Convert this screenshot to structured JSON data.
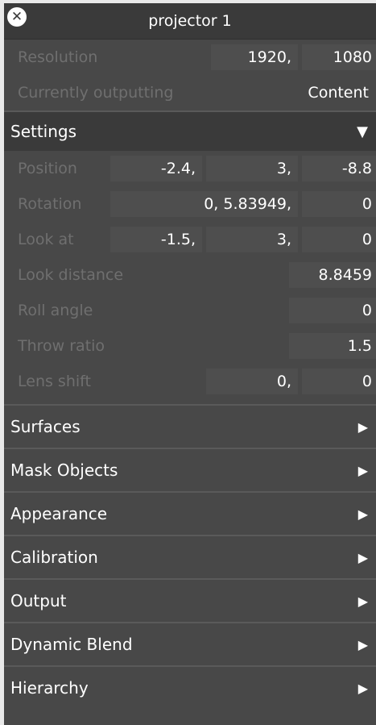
{
  "window": {
    "title": "projector 1"
  },
  "info": {
    "resolution": {
      "label": "Resolution",
      "w": "1920,",
      "h": "1080"
    },
    "outputting": {
      "label": "Currently outputting",
      "value": "Content"
    }
  },
  "settings": {
    "label": "Settings",
    "position": {
      "label": "Position",
      "x": "-2.4,",
      "y": "3,",
      "z": "-8.8"
    },
    "rotation": {
      "label": "Rotation",
      "xy": "0, 5.83949,",
      "z": "0"
    },
    "look_at": {
      "label": "Look at",
      "x": "-1.5,",
      "y": "3,",
      "z": "0"
    },
    "look_distance": {
      "label": "Look distance",
      "value": "8.8459"
    },
    "roll_angle": {
      "label": "Roll angle",
      "value": "0"
    },
    "throw_ratio": {
      "label": "Throw ratio",
      "value": "1.5"
    },
    "lens_shift": {
      "label": "Lens shift",
      "x": "0,",
      "y": "0"
    }
  },
  "sections": [
    {
      "label": "Surfaces"
    },
    {
      "label": "Mask Objects"
    },
    {
      "label": "Appearance"
    },
    {
      "label": "Calibration"
    },
    {
      "label": "Output"
    },
    {
      "label": "Dynamic Blend"
    },
    {
      "label": "Hierarchy"
    }
  ],
  "icons": {
    "close": "close-icon",
    "expanded": "triangle-down-icon",
    "collapsed": "triangle-right-icon"
  }
}
